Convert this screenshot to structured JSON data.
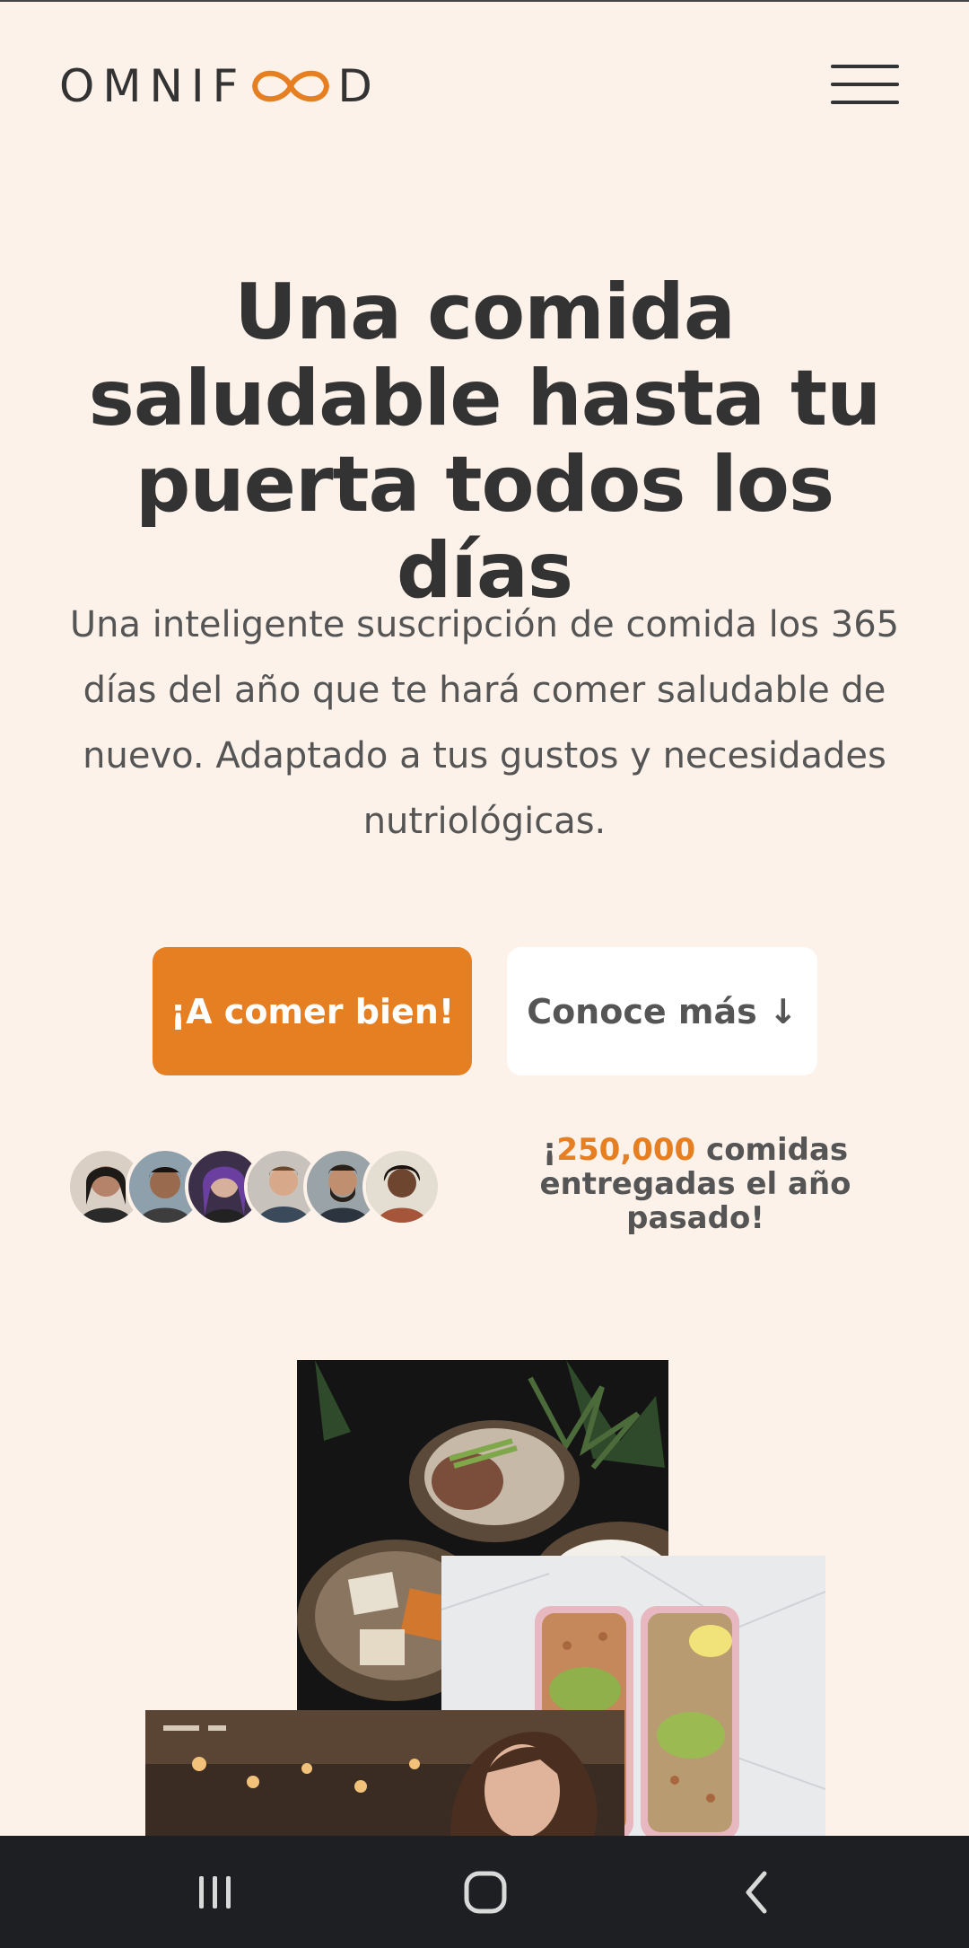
{
  "header": {
    "logo_text_start": "OMNIF",
    "logo_text_end": "D",
    "menu_icon": "hamburger-menu-icon"
  },
  "hero": {
    "title_line1": "Una comida",
    "title_line2": "saludable hasta tu",
    "title_line3": "puerta todos los días",
    "description": "Una inteligente suscripción de comida los 365 días del año que te hará comer saludable de nuevo. Adaptado a tus gustos y necesidades nutriológicas.",
    "cta_primary": "¡A comer bien!",
    "cta_secondary": "Conoce más ↓"
  },
  "delivered": {
    "prefix": "¡",
    "highlight": "250,000",
    "suffix": " comidas entregadas el año pasado!"
  },
  "colors": {
    "background": "#fdf2e9",
    "accent": "#e67e22",
    "text": "#333333",
    "navbar": "#1d1f22"
  },
  "system_nav": {
    "recents_icon": "recent-apps-icon",
    "home_icon": "home-icon",
    "back_icon": "back-icon"
  }
}
